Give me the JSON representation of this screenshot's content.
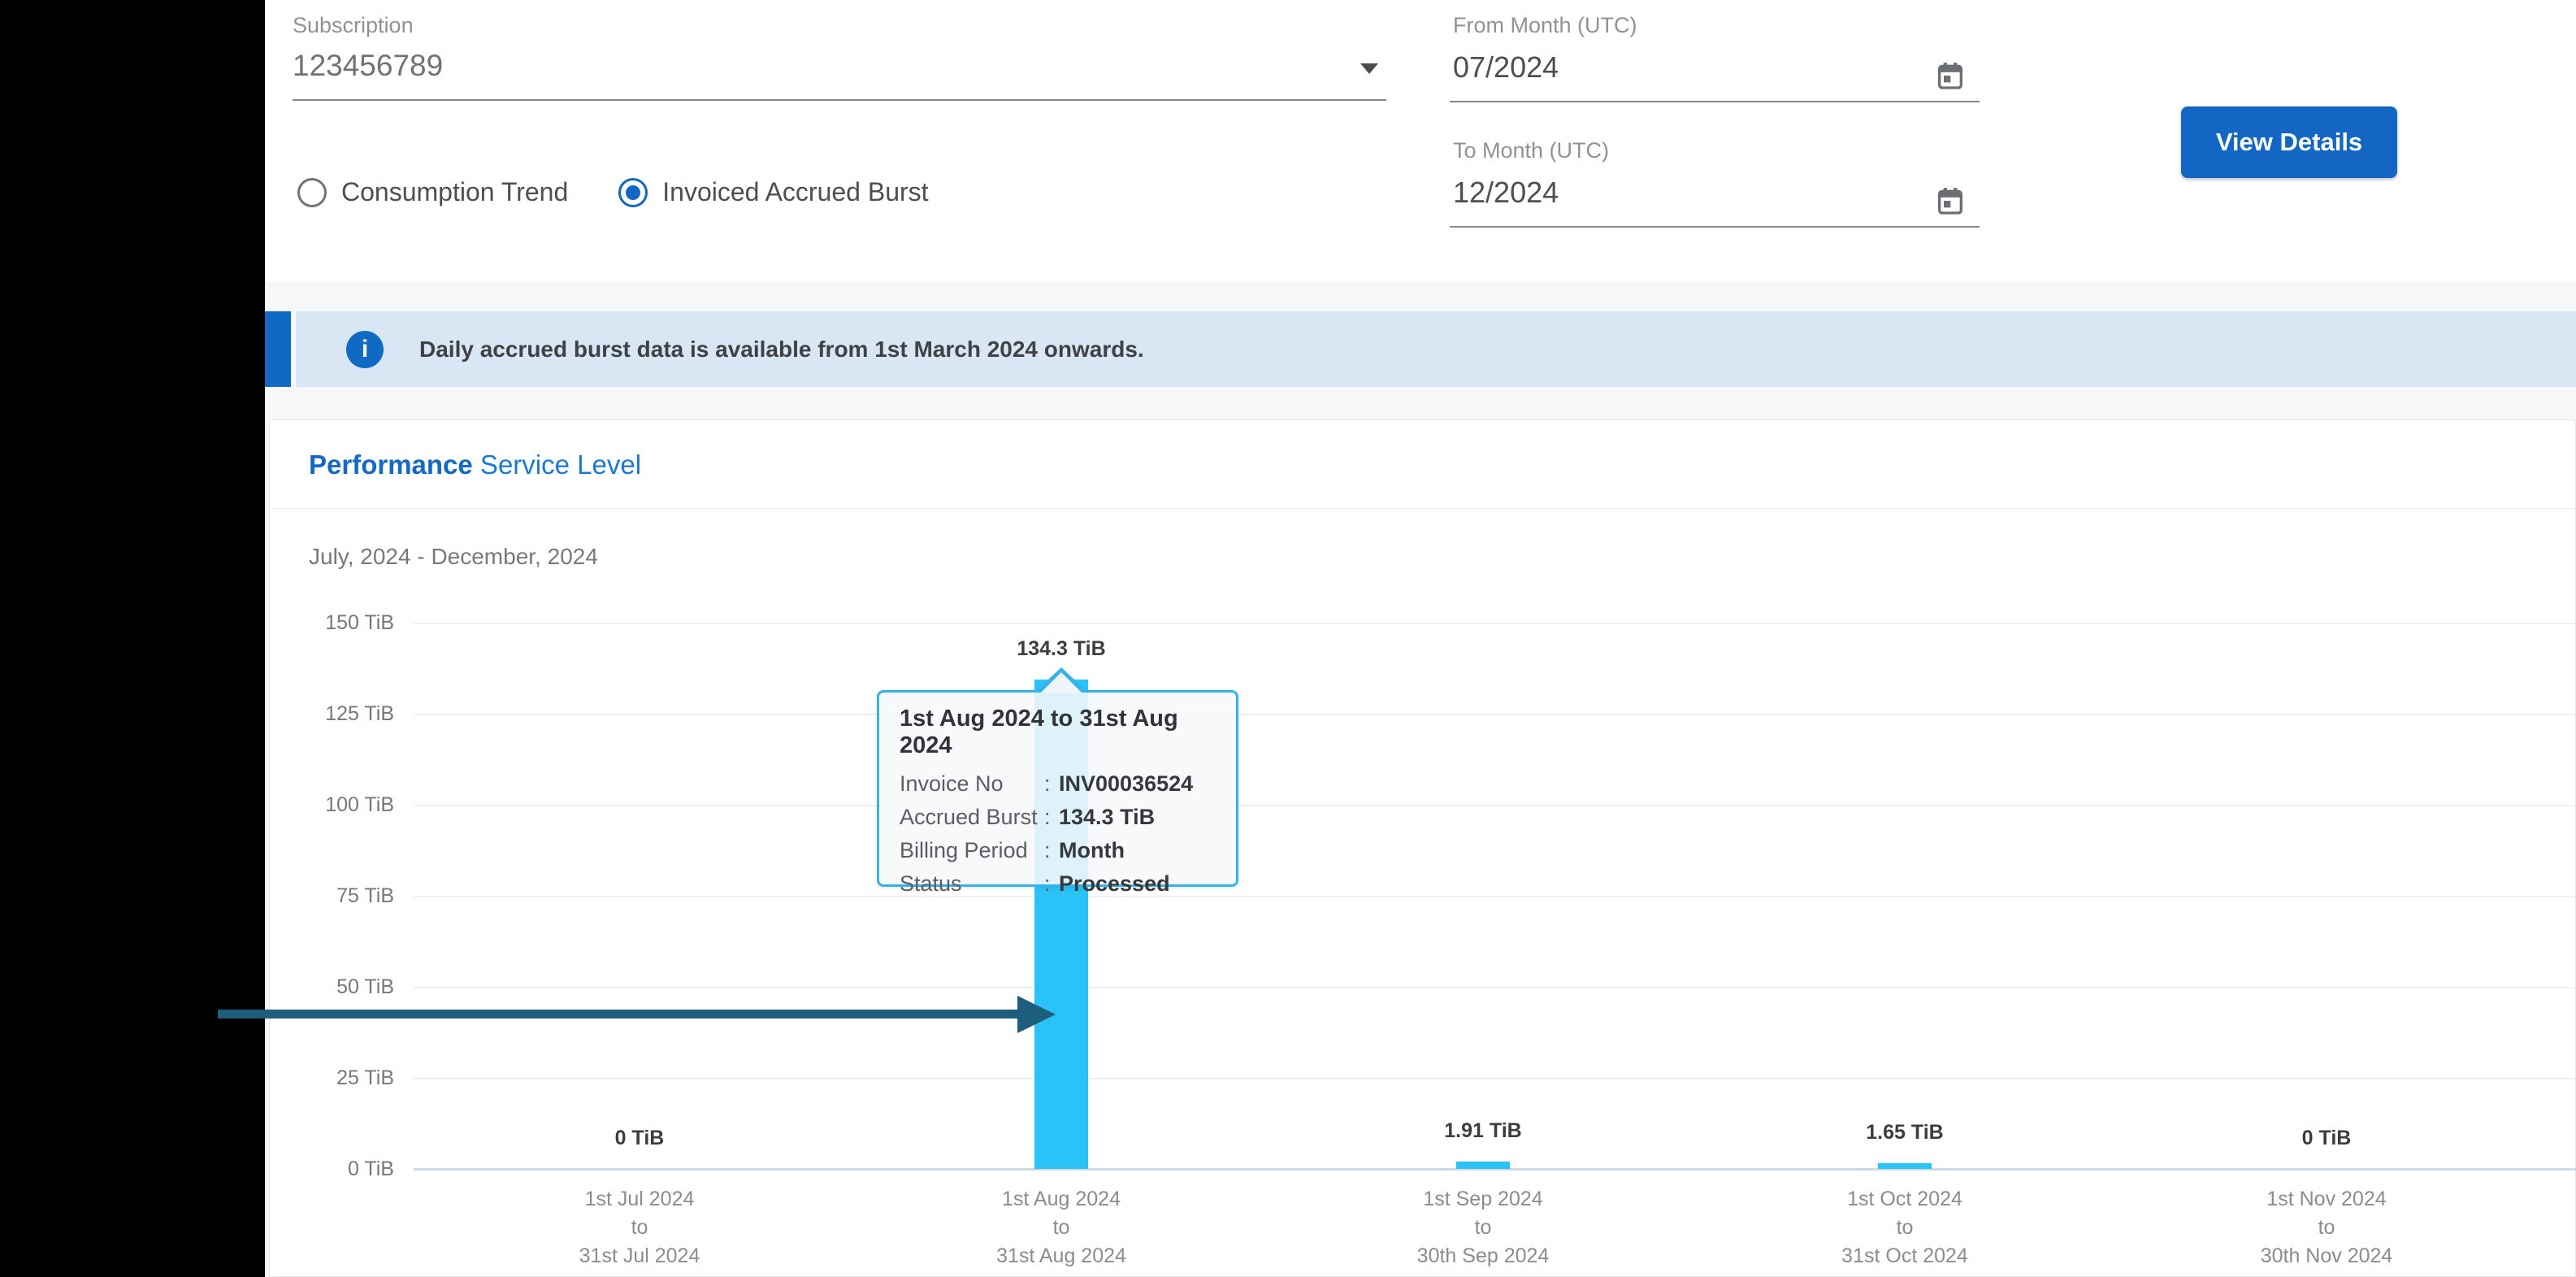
{
  "colors": {
    "blue": "#1366c3",
    "accent_blue": "#1069c3",
    "bar_color": "#29c3f7",
    "tooltip_border": "#35b2ea",
    "arrow_color": "#1d5e7c"
  },
  "filters": {
    "subscription": {
      "label": "Subscription",
      "value": "123456789"
    },
    "from_month": {
      "label": "From Month (UTC)",
      "value": "07/2024"
    },
    "to_month": {
      "label": "To Month (UTC)",
      "value": "12/2024"
    },
    "radios": [
      {
        "label": "Consumption Trend",
        "selected": false
      },
      {
        "label": "Invoiced Accrued Burst",
        "selected": true
      }
    ],
    "view_details_label": "View Details"
  },
  "banner": {
    "text": "Daily accrued burst data is available from 1st March 2024 onwards."
  },
  "chart_card": {
    "title_bold": "Performance",
    "title_rest": " Service Level",
    "subtitle": "July, 2024 - December, 2024"
  },
  "tooltip": {
    "title": "1st Aug 2024 to 31st Aug 2024",
    "colon": ":",
    "rows": [
      {
        "label": "Invoice No",
        "value": "INV00036524"
      },
      {
        "label": "Accrued Burst",
        "value": "134.3 TiB"
      },
      {
        "label": "Billing Period",
        "value": "Month"
      },
      {
        "label": "Status",
        "value": "Processed"
      }
    ]
  },
  "chart_data": {
    "type": "bar",
    "title": "July, 2024 - December, 2024",
    "ylabel": "TiB",
    "ylim": [
      0,
      150
    ],
    "grid": true,
    "y_ticks": [
      {
        "value": 150,
        "label": "150 TiB"
      },
      {
        "value": 125,
        "label": "125 TiB"
      },
      {
        "value": 100,
        "label": "100 TiB"
      },
      {
        "value": 75,
        "label": "75 TiB"
      },
      {
        "value": 50,
        "label": "50 TiB"
      },
      {
        "value": 25,
        "label": "25 TiB"
      },
      {
        "value": 0,
        "label": "0 TiB"
      }
    ],
    "categories": [
      [
        "1st Jul 2024",
        "to",
        "31st Jul 2024"
      ],
      [
        "1st Aug 2024",
        "to",
        "31st Aug 2024"
      ],
      [
        "1st Sep 2024",
        "to",
        "30th Sep 2024"
      ],
      [
        "1st Oct 2024",
        "to",
        "31st Oct 2024"
      ],
      [
        "1st Nov 2024",
        "to",
        "30th Nov 2024"
      ]
    ],
    "values": [
      0,
      134.3,
      1.91,
      1.65,
      0
    ],
    "value_labels": [
      "0 TiB",
      "134.3 TiB",
      "1.91 TiB",
      "1.65 TiB",
      "0 TiB"
    ],
    "highlighted_index": 1
  }
}
